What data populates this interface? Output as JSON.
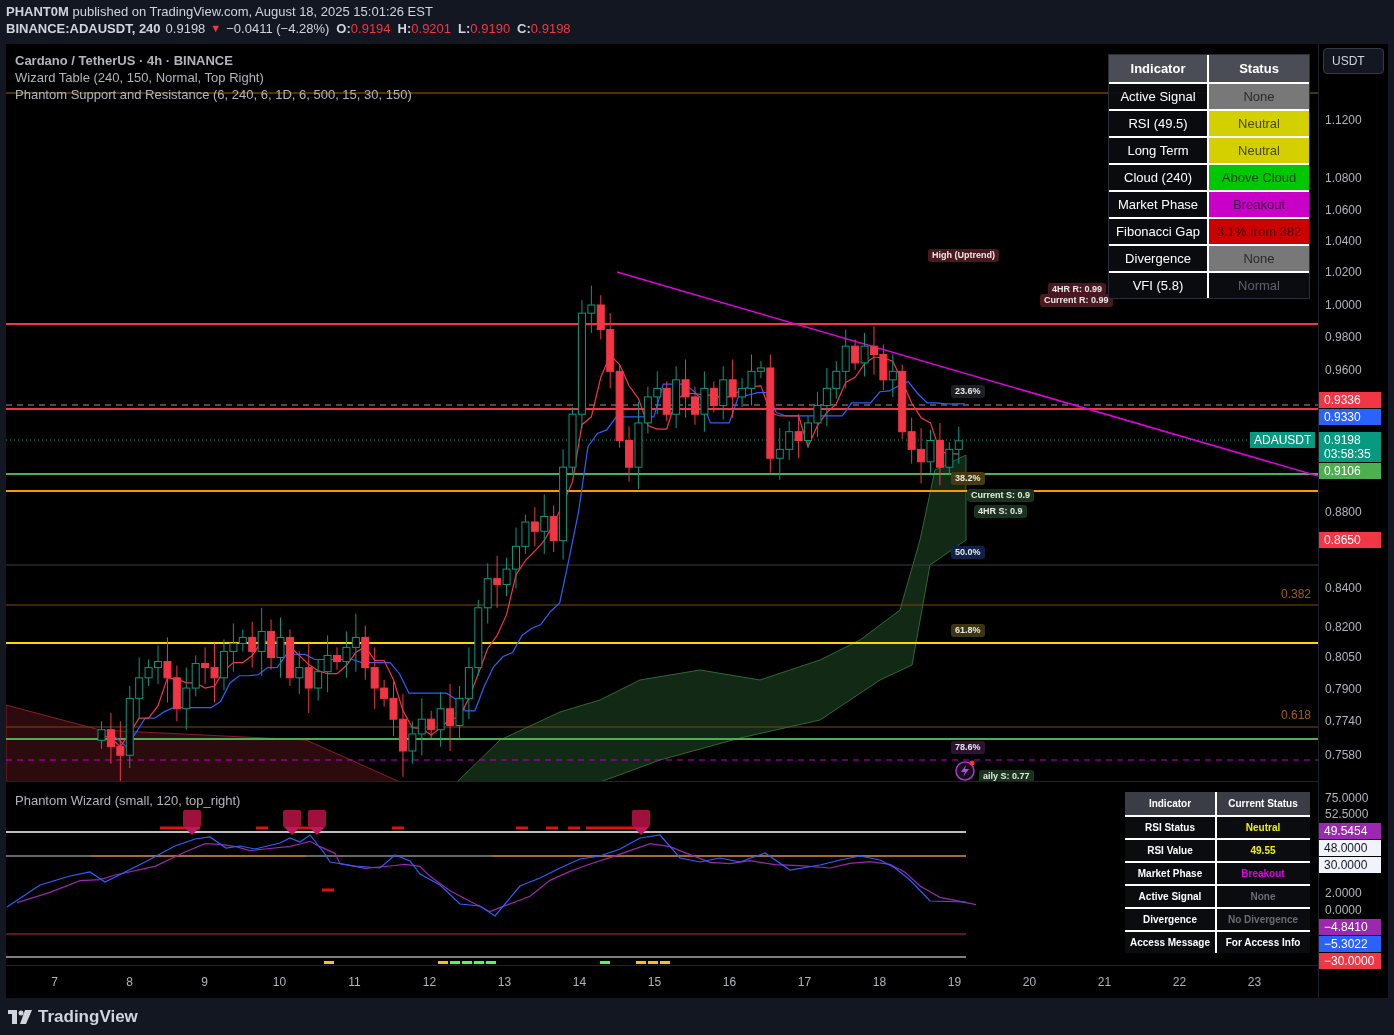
{
  "header": {
    "published": "**PHANT0M** published on TradingView.com, August 18, 2025 15:01:26 EST"
  },
  "symbol_bar": {
    "symbol": "BINANCE:ADAUSDT, 240",
    "price": "0.9198",
    "direction_icon": "▼",
    "change": "−0.0411 (−4.28%)",
    "ohlc": [
      {
        "label": "O:",
        "value": "0.9194"
      },
      {
        "label": "H:",
        "value": "0.9201"
      },
      {
        "label": "L:",
        "value": "0.9190"
      },
      {
        "label": "C:",
        "value": "0.9198"
      }
    ]
  },
  "legend": [
    "Cardano / TetherUS · 4h · BINANCE",
    "Wizard Table (240, 150, Normal, Top Right)",
    "Phantom Support and Resistance (6, 240, 6, 1D, 6, 500, 15, 30, 150)"
  ],
  "wizard_table": {
    "columns": [
      "Indicator",
      "Status"
    ],
    "rows": [
      {
        "indicator": "Active Signal",
        "status": "None",
        "color": "#787878"
      },
      {
        "indicator": "RSI (49.5)",
        "status": "Neutral",
        "color": "#d4d000"
      },
      {
        "indicator": "Long Term",
        "status": "Neutral",
        "color": "#d4d000"
      },
      {
        "indicator": "Cloud (240)",
        "status": "Above Cloud",
        "color": "#00c800"
      },
      {
        "indicator": "Market Phase",
        "status": "Breakout",
        "color": "#c800c8"
      },
      {
        "indicator": "Fibonacci Gap",
        "status": "3.1% from 382",
        "color": "#cc0000"
      },
      {
        "indicator": "Divergence",
        "status": "None",
        "color": "#787878"
      },
      {
        "indicator": "VFI (5.8)",
        "status": "Normal",
        "color": "#0b0c0f"
      }
    ]
  },
  "chart_labels": [
    {
      "text": "High (Uptrend)",
      "color": "#4a1820"
    },
    {
      "text": "4HR R: 0.99",
      "color": "#4a1820"
    },
    {
      "text": "Current R: 0.99",
      "color": "#4a1820"
    },
    {
      "text": "23.6%",
      "color": "#1e1f24"
    },
    {
      "text": "38.2%",
      "color": "#4a3a10"
    },
    {
      "text": "Current S: 0.9",
      "color": "#1a331c"
    },
    {
      "text": "4HR S: 0.9",
      "color": "#1a331c"
    },
    {
      "text": "50.0%",
      "color": "#10224a"
    },
    {
      "text": "61.8%",
      "color": "#3c3412"
    },
    {
      "text": "78.6%",
      "color": "#2c1234"
    },
    {
      "text": "aily S: 0.77",
      "color": "#1a331c"
    }
  ],
  "fib_labels": [
    "0.382",
    "0.618"
  ],
  "currency_button": "USDT",
  "symbol_tag": "ADAUSDT",
  "price_axis": [
    {
      "text": "1.1200",
      "kind": "tick"
    },
    {
      "text": "1.0800",
      "kind": "tick"
    },
    {
      "text": "1.0600",
      "kind": "tick"
    },
    {
      "text": "1.0400",
      "kind": "tick"
    },
    {
      "text": "1.0200",
      "kind": "tick"
    },
    {
      "text": "1.0000",
      "kind": "tick"
    },
    {
      "text": "0.9800",
      "kind": "tick"
    },
    {
      "text": "0.9600",
      "kind": "tick"
    },
    {
      "text": "0.9336",
      "kind": "tag",
      "color": "#f23645"
    },
    {
      "text": "0.9330",
      "kind": "tag",
      "color": "#2962ff"
    },
    {
      "text": "0.9198",
      "subtext": "03:58:35",
      "kind": "tag",
      "color": "#089981"
    },
    {
      "text": "0.9106",
      "kind": "tag",
      "color": "#4caf50"
    },
    {
      "text": "0.8800",
      "kind": "tick"
    },
    {
      "text": "0.8650",
      "kind": "tag",
      "color": "#f23645"
    },
    {
      "text": "0.8400",
      "kind": "tick"
    },
    {
      "text": "0.8200",
      "kind": "tick"
    },
    {
      "text": "0.8050",
      "kind": "tick"
    },
    {
      "text": "0.7900",
      "kind": "tick"
    },
    {
      "text": "0.7740",
      "kind": "tick"
    },
    {
      "text": "0.7580",
      "kind": "tick"
    }
  ],
  "indicator_pane": {
    "title": "Phantom Wizard (small, 120, top_right)",
    "table": {
      "columns": [
        "Indicator",
        "Current Status"
      ],
      "rows": [
        {
          "indicator": "RSI Status",
          "status": "Neutral",
          "kind": "neutral"
        },
        {
          "indicator": "RSI Value",
          "status": "49.55",
          "kind": "neutral"
        },
        {
          "indicator": "Market Phase",
          "status": "Breakout",
          "kind": "breakout"
        },
        {
          "indicator": "Active Signal",
          "status": "None",
          "kind": "muted"
        },
        {
          "indicator": "Divergence",
          "status": "No Divergence",
          "kind": "muted"
        },
        {
          "indicator": "Access Message",
          "status": "For Access Info",
          "kind": "info"
        }
      ]
    },
    "axis": [
      {
        "text": "75.0000",
        "kind": "tick"
      },
      {
        "text": "52.5000",
        "kind": "tick"
      },
      {
        "text": "49.5454",
        "kind": "tag",
        "color": "#9c27b0"
      },
      {
        "text": "48.0000",
        "kind": "light_tag",
        "color": "#f0f3fa"
      },
      {
        "text": "30.0000",
        "kind": "light_tag",
        "color": "#f0f3fa"
      },
      {
        "text": "2.0000",
        "kind": "tick"
      },
      {
        "text": "0.0000",
        "kind": "tick"
      },
      {
        "text": "−4.8410",
        "kind": "tag",
        "color": "#9c27b0"
      },
      {
        "text": "−5.3022",
        "kind": "tag",
        "color": "#2962ff"
      },
      {
        "text": "−30.0000",
        "kind": "tag",
        "color": "#f23645"
      }
    ]
  },
  "time_axis": [
    "7",
    "8",
    "9",
    "10",
    "11",
    "12",
    "13",
    "14",
    "15",
    "16",
    "17",
    "18",
    "19",
    "20",
    "21",
    "22",
    "23"
  ],
  "footer": {
    "brand": "TradingView"
  }
}
